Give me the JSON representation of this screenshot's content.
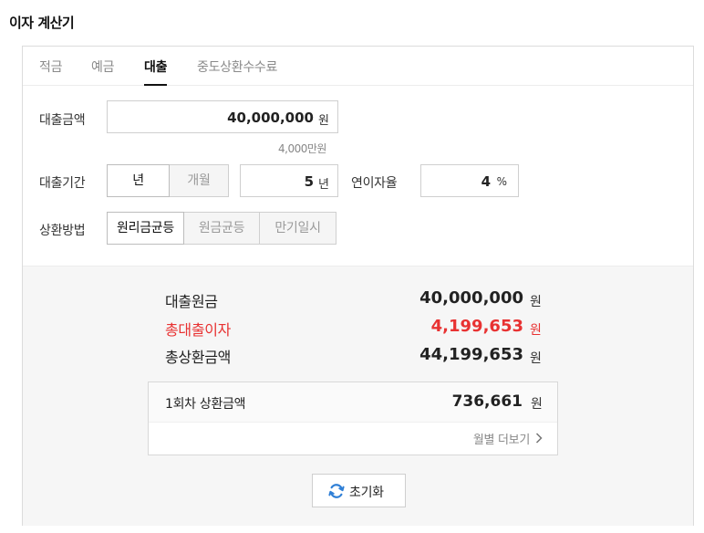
{
  "title": "이자 계산기",
  "tabs": [
    {
      "label": "적금"
    },
    {
      "label": "예금"
    },
    {
      "label": "대출"
    },
    {
      "label": "중도상환수수료"
    }
  ],
  "active_tab": "대출",
  "loan_amount": {
    "label": "대출금액",
    "value": "40,000,000",
    "unit": "원",
    "hint": "4,000만원"
  },
  "loan_period": {
    "label": "대출기간",
    "unit_options": [
      {
        "label": "년"
      },
      {
        "label": "개월"
      }
    ],
    "selected_unit": "년",
    "value": "5",
    "unit": "년"
  },
  "interest_rate": {
    "label": "연이자율",
    "value": "4",
    "unit": "%"
  },
  "repayment_method": {
    "label": "상환방법",
    "options": [
      {
        "label": "원리금균등"
      },
      {
        "label": "원금균등"
      },
      {
        "label": "만기일시"
      }
    ],
    "selected": "원리금균등"
  },
  "results": {
    "principal": {
      "label": "대출원금",
      "value": "40,000,000",
      "unit": "원"
    },
    "total_interest": {
      "label": "총대출이자",
      "value": "4,199,653",
      "unit": "원"
    },
    "total_repayment": {
      "label": "총상환금액",
      "value": "44,199,653",
      "unit": "원"
    },
    "first_payment": {
      "label": "1회차 상환금액",
      "value": "736,661",
      "unit": "원"
    },
    "monthly_more": "월별 더보기"
  },
  "reset_label": "초기화",
  "colors": {
    "accent_red": "#e83232",
    "reset_icon": "#2f7fd6"
  }
}
